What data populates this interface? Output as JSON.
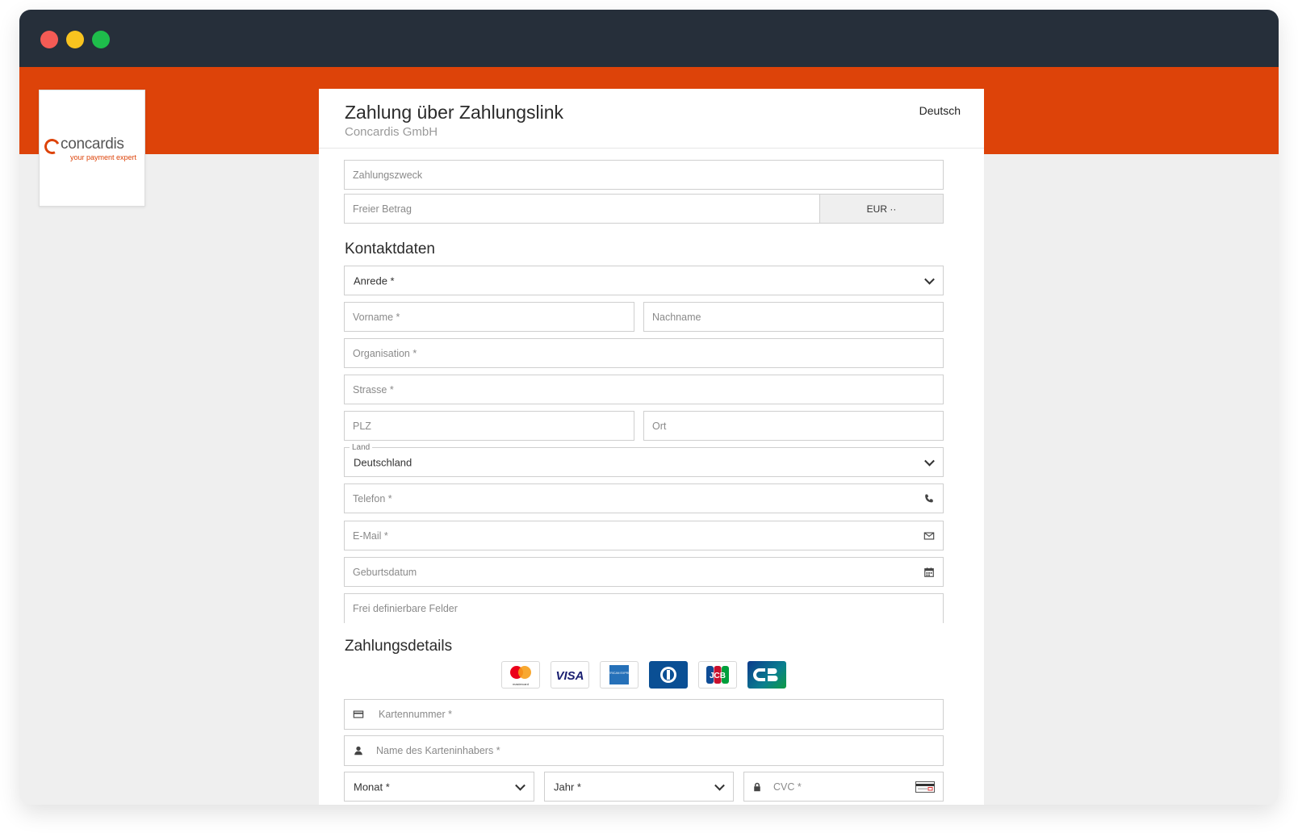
{
  "window": {
    "traffic_lights": [
      "close",
      "minimize",
      "maximize"
    ]
  },
  "logo": {
    "word": "concardis",
    "tagline": "your payment expert"
  },
  "header": {
    "title": "Zahlung über Zahlungslink",
    "subtitle": "Concardis GmbH",
    "language": "Deutsch"
  },
  "payment": {
    "purpose_placeholder": "Zahlungszweck",
    "amount_placeholder": "Freier Betrag",
    "currency": "EUR ··"
  },
  "contact": {
    "heading": "Kontaktdaten",
    "salutation": "Anrede *",
    "first_name": "Vorname *",
    "last_name": "Nachname",
    "organisation": "Organisation *",
    "street": "Strasse *",
    "zip": "PLZ",
    "city": "Ort",
    "country_label": "Land",
    "country_value": "Deutschland",
    "phone": "Telefon *",
    "email": "E-Mail *",
    "birthdate": "Geburtsdatum",
    "custom_fields": "Frei definierbare Felder"
  },
  "card": {
    "heading": "Zahlungsdetails",
    "brands": [
      "mastercard",
      "VISA",
      "american express",
      "diners club",
      "JCB",
      "CB"
    ],
    "mastercard_label": "mastercard",
    "visa_label": "VISA",
    "jcb_label": "JCB",
    "amex_label": "AMERICAN EXPRESS",
    "number": "Kartennummer *",
    "holder": "Name des Karteninhabers *",
    "month": "Monat *",
    "year": "Jahr *",
    "cvc": "CVC *"
  },
  "colors": {
    "brand": "#dd4309",
    "titlebar": "#262f3a",
    "background": "#efefef"
  }
}
